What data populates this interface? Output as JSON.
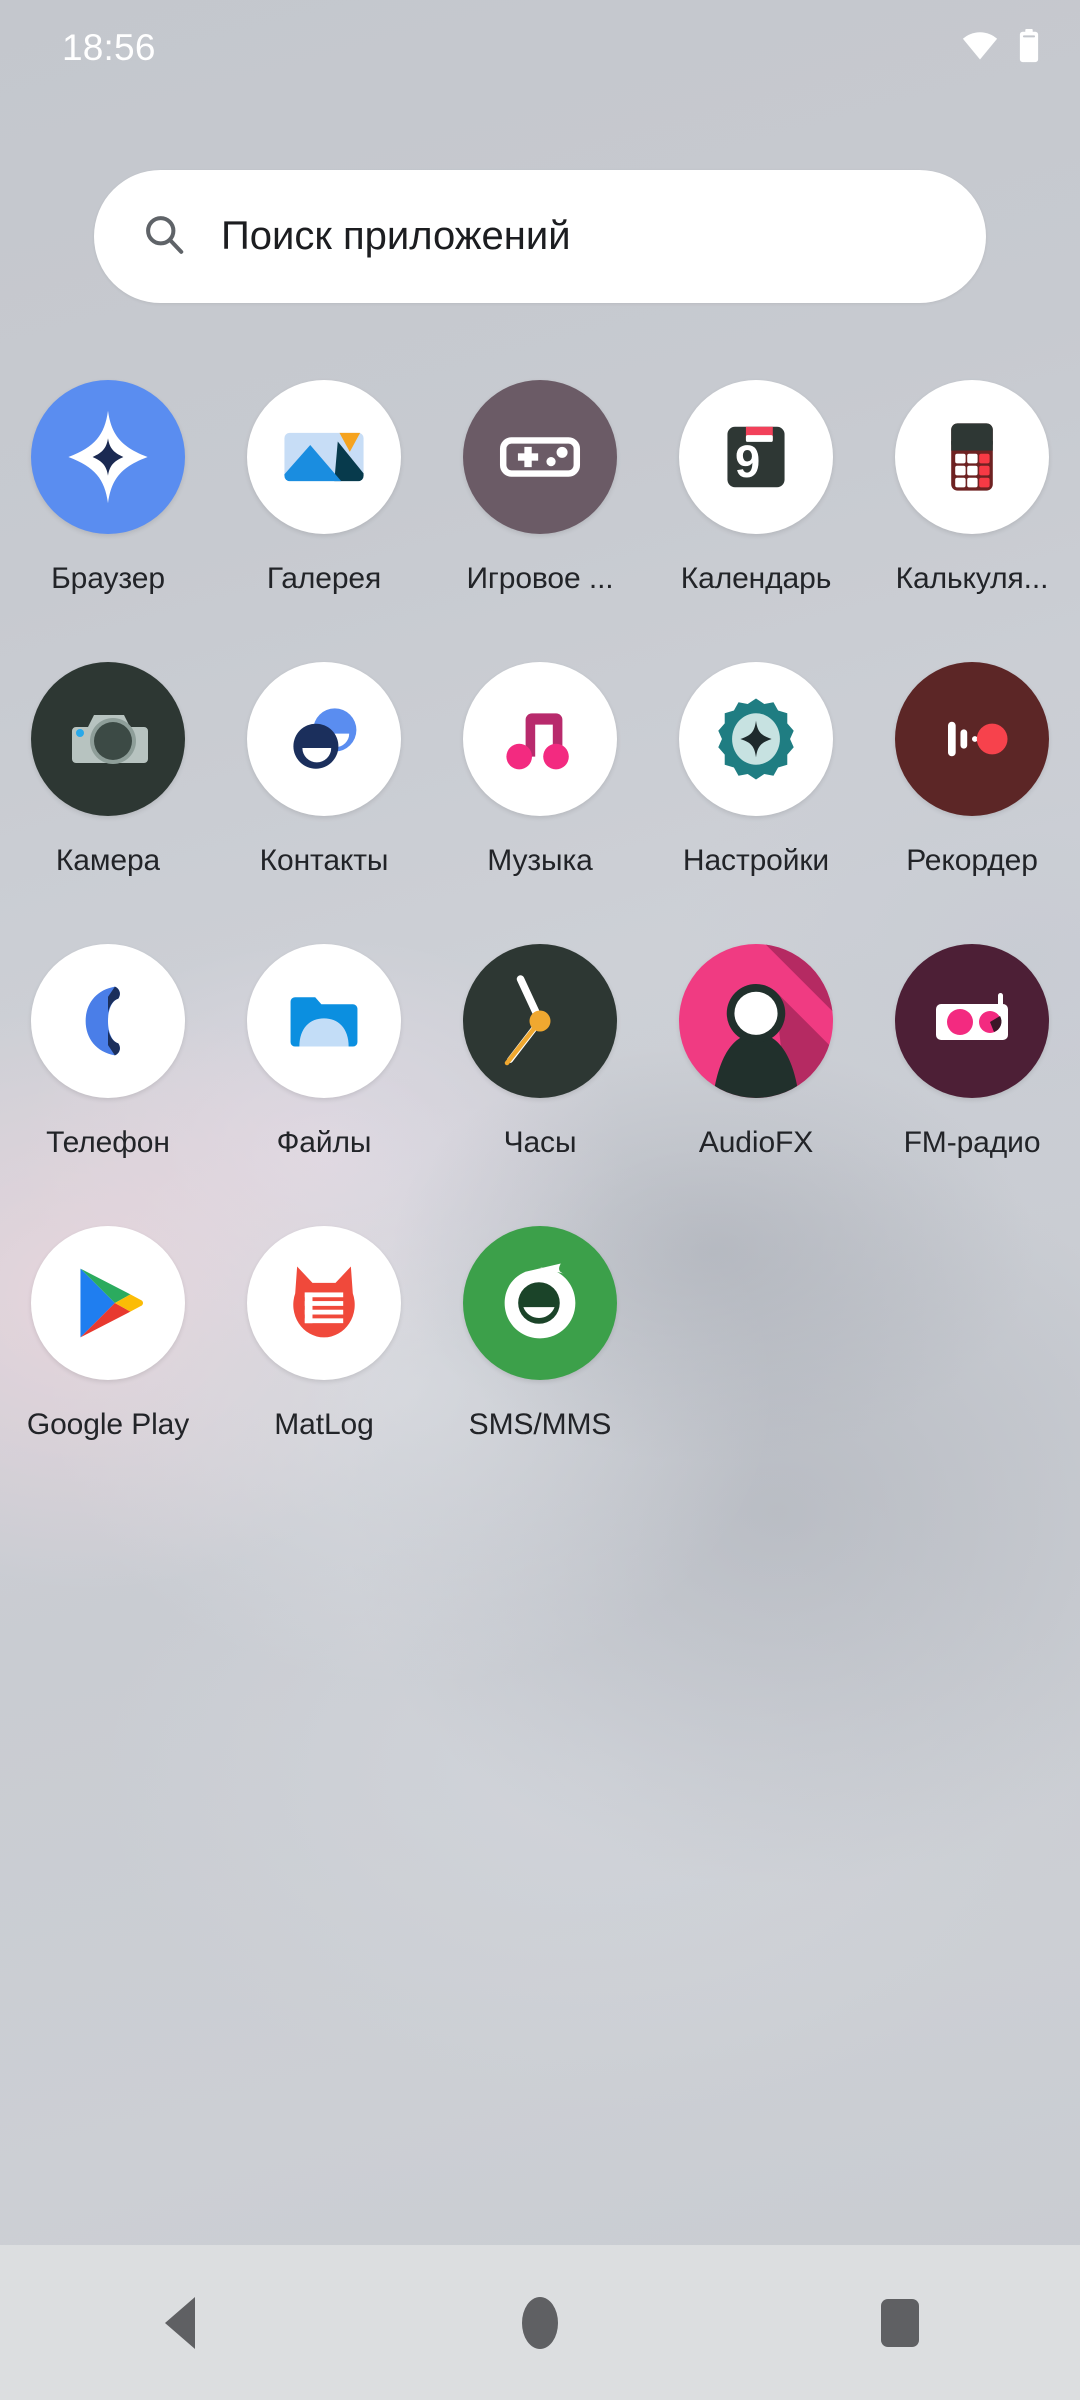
{
  "status_bar": {
    "time": "18:56",
    "wifi_icon": "wifi-full-icon",
    "battery_icon": "battery-full-icon"
  },
  "search": {
    "icon": "search-icon",
    "placeholder": "Поиск приложений"
  },
  "apps": [
    {
      "label": "Браузер",
      "icon": "browser-icon",
      "bg": "#5a8df0"
    },
    {
      "label": "Галерея",
      "icon": "gallery-icon",
      "bg": "#ffffff"
    },
    {
      "label": "Игровое ...",
      "icon": "gamepad-icon",
      "bg": "#6b5b66"
    },
    {
      "label": "Календарь",
      "icon": "calendar-icon",
      "bg": "#ffffff"
    },
    {
      "label": "Калькуля...",
      "icon": "calculator-icon",
      "bg": "#ffffff"
    },
    {
      "label": "Камера",
      "icon": "camera-icon",
      "bg": "#2d3733"
    },
    {
      "label": "Контакты",
      "icon": "contacts-icon",
      "bg": "#ffffff"
    },
    {
      "label": "Музыка",
      "icon": "music-icon",
      "bg": "#ffffff"
    },
    {
      "label": "Настройки",
      "icon": "settings-gear-icon",
      "bg": "#ffffff"
    },
    {
      "label": "Рекордер",
      "icon": "recorder-icon",
      "bg": "#5c2626"
    },
    {
      "label": "Телефон",
      "icon": "phone-icon",
      "bg": "#ffffff"
    },
    {
      "label": "Файлы",
      "icon": "files-folder-icon",
      "bg": "#ffffff"
    },
    {
      "label": "Часы",
      "icon": "clock-icon",
      "bg": "#2d3733"
    },
    {
      "label": "AudioFX",
      "icon": "audiofx-icon",
      "bg": "#f03b82"
    },
    {
      "label": "FM-радио",
      "icon": "fm-radio-icon",
      "bg": "#4d1f36"
    },
    {
      "label": "Google Play",
      "icon": "google-play-icon",
      "bg": "#ffffff"
    },
    {
      "label": "MatLog",
      "icon": "matlog-icon",
      "bg": "#ffffff"
    },
    {
      "label": "SMS/MMS",
      "icon": "sms-mms-icon",
      "bg": "#3ca04a"
    }
  ],
  "nav_bar": {
    "back": "back-triangle-icon",
    "home": "home-circle-icon",
    "recents": "recents-square-icon"
  },
  "colors": {
    "accent_blue": "#5a8df0",
    "accent_pink": "#f03b82",
    "accent_green": "#3ca04a",
    "text_primary": "#222428",
    "navbar_bg": "#dcdee0"
  }
}
